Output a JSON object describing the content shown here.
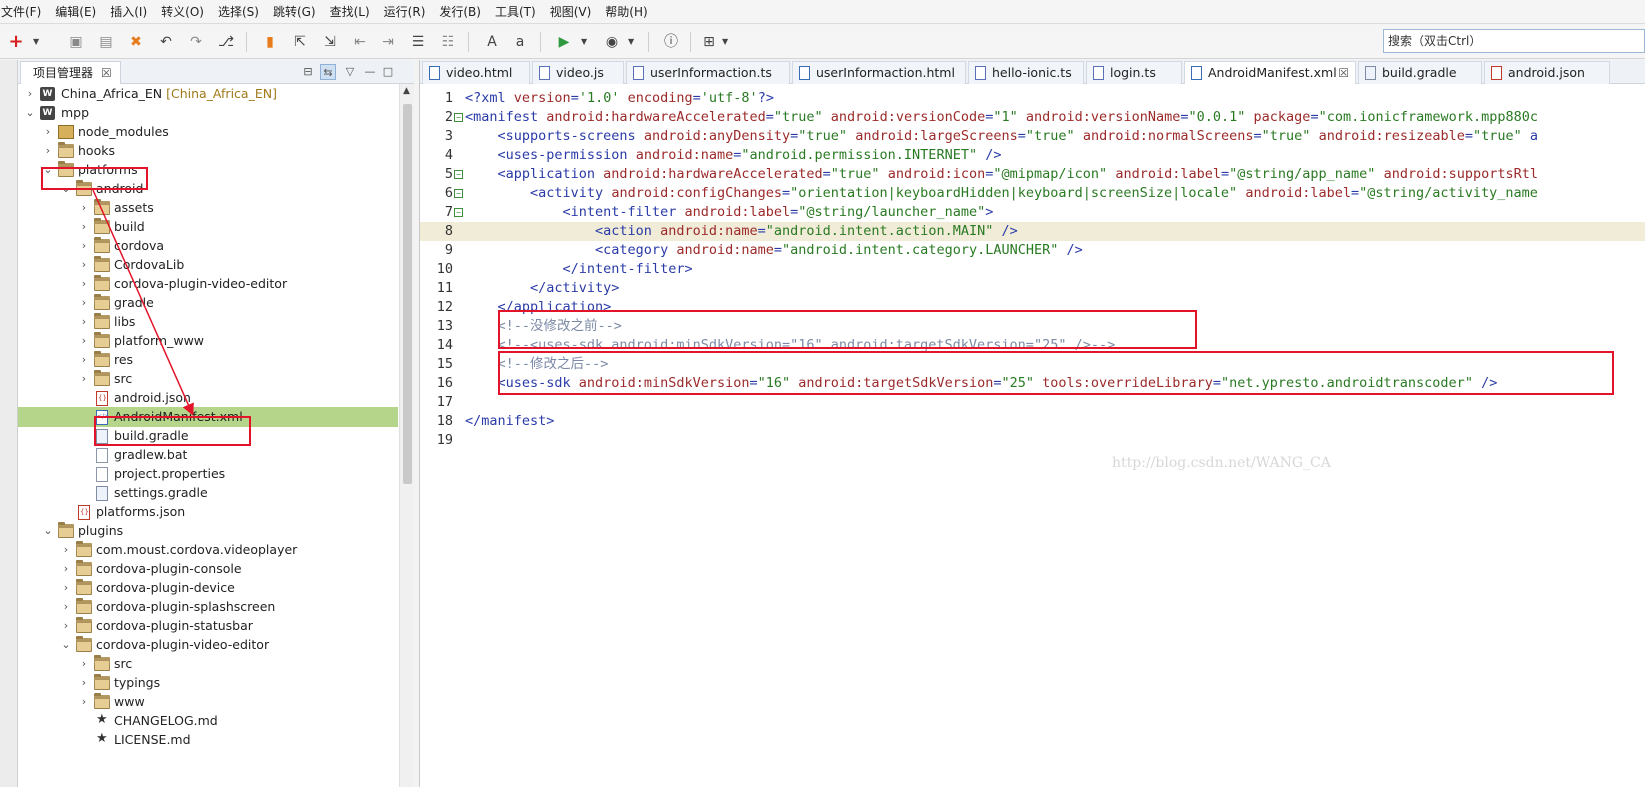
{
  "menu": [
    "文件(F)",
    "编辑(E)",
    "插入(I)",
    "转义(O)",
    "选择(S)",
    "跳转(G)",
    "查找(L)",
    "运行(R)",
    "发行(B)",
    "工具(T)",
    "视图(V)",
    "帮助(H)"
  ],
  "search": {
    "placeholder": "搜索（双击Ctrl）"
  },
  "project_panel": {
    "title": "项目管理器",
    "close": "☒"
  },
  "tree": [
    {
      "label": "China_Africa_EN",
      "extra": "[China_Africa_EN]"
    },
    {
      "label": "mpp"
    },
    {
      "label": "node_modules"
    },
    {
      "label": "hooks"
    },
    {
      "label": "platforms"
    },
    {
      "label": "android"
    },
    {
      "label": "assets"
    },
    {
      "label": "build"
    },
    {
      "label": "cordova"
    },
    {
      "label": "CordovaLib"
    },
    {
      "label": "cordova-plugin-video-editor"
    },
    {
      "label": "gradle"
    },
    {
      "label": "libs"
    },
    {
      "label": "platform_www"
    },
    {
      "label": "res"
    },
    {
      "label": "src"
    },
    {
      "label": "android.json"
    },
    {
      "label": "AndroidManifest.xml"
    },
    {
      "label": "build.gradle"
    },
    {
      "label": "gradlew.bat"
    },
    {
      "label": "project.properties"
    },
    {
      "label": "settings.gradle"
    },
    {
      "label": "platforms.json"
    },
    {
      "label": "plugins"
    },
    {
      "label": "com.moust.cordova.videoplayer"
    },
    {
      "label": "cordova-plugin-console"
    },
    {
      "label": "cordova-plugin-device"
    },
    {
      "label": "cordova-plugin-splashscreen"
    },
    {
      "label": "cordova-plugin-statusbar"
    },
    {
      "label": "cordova-plugin-video-editor"
    },
    {
      "label": "src"
    },
    {
      "label": "typings"
    },
    {
      "label": "www"
    },
    {
      "label": "CHANGELOG.md"
    },
    {
      "label": "LICENSE.md"
    }
  ],
  "tabs": [
    {
      "label": "video.html"
    },
    {
      "label": "video.js"
    },
    {
      "label": "userInformaction.ts"
    },
    {
      "label": "userInformaction.html"
    },
    {
      "label": "hello-ionic.ts"
    },
    {
      "label": "login.ts"
    },
    {
      "label": "AndroidManifest.xml",
      "close": "☒"
    },
    {
      "label": "build.gradle"
    },
    {
      "label": "android.json"
    }
  ],
  "code_lines": [
    {
      "n": "1",
      "tokens": [
        [
          "t-tag",
          "<?xml "
        ],
        [
          "t-attr",
          "version"
        ],
        [
          "t-tag",
          "="
        ],
        [
          "t-val",
          "'1.0'"
        ],
        [
          "t-tag",
          " "
        ],
        [
          "t-attr",
          "encoding"
        ],
        [
          "t-tag",
          "="
        ],
        [
          "t-val",
          "'utf-8'"
        ],
        [
          "t-tag",
          "?>"
        ]
      ]
    },
    {
      "n": "2",
      "tokens": [
        [
          "t-tag",
          "<manifest "
        ],
        [
          "t-attr",
          "android:hardwareAccelerated"
        ],
        [
          "t-tag",
          "="
        ],
        [
          "t-val",
          "\"true\""
        ],
        [
          "t-tag",
          " "
        ],
        [
          "t-attr",
          "android:versionCode"
        ],
        [
          "t-tag",
          "="
        ],
        [
          "t-val",
          "\"1\""
        ],
        [
          "t-tag",
          " "
        ],
        [
          "t-attr",
          "android:versionName"
        ],
        [
          "t-tag",
          "="
        ],
        [
          "t-val",
          "\"0.0.1\""
        ],
        [
          "t-tag",
          " "
        ],
        [
          "t-attr",
          "package"
        ],
        [
          "t-tag",
          "="
        ],
        [
          "t-val",
          "\"com.ionicframework.mpp880c"
        ]
      ]
    },
    {
      "n": "3",
      "tokens": [
        [
          "t-tag",
          "    <supports-screens "
        ],
        [
          "t-attr",
          "android:anyDensity"
        ],
        [
          "t-tag",
          "="
        ],
        [
          "t-val",
          "\"true\""
        ],
        [
          "t-tag",
          " "
        ],
        [
          "t-attr",
          "android:largeScreens"
        ],
        [
          "t-tag",
          "="
        ],
        [
          "t-val",
          "\"true\""
        ],
        [
          "t-tag",
          " "
        ],
        [
          "t-attr",
          "android:normalScreens"
        ],
        [
          "t-tag",
          "="
        ],
        [
          "t-val",
          "\"true\""
        ],
        [
          "t-tag",
          " "
        ],
        [
          "t-attr",
          "android:resizeable"
        ],
        [
          "t-tag",
          "="
        ],
        [
          "t-val",
          "\"true\""
        ],
        [
          "t-tag",
          " a"
        ]
      ]
    },
    {
      "n": "4",
      "tokens": [
        [
          "t-tag",
          "    <uses-permission "
        ],
        [
          "t-attr",
          "android:name"
        ],
        [
          "t-tag",
          "="
        ],
        [
          "t-val",
          "\"android.permission.INTERNET\""
        ],
        [
          "t-tag",
          " />"
        ]
      ]
    },
    {
      "n": "5",
      "tokens": [
        [
          "t-tag",
          "    <application "
        ],
        [
          "t-attr",
          "android:hardwareAccelerated"
        ],
        [
          "t-tag",
          "="
        ],
        [
          "t-val",
          "\"true\""
        ],
        [
          "t-tag",
          " "
        ],
        [
          "t-attr",
          "android:icon"
        ],
        [
          "t-tag",
          "="
        ],
        [
          "t-val",
          "\"@mipmap/icon\""
        ],
        [
          "t-tag",
          " "
        ],
        [
          "t-attr",
          "android:label"
        ],
        [
          "t-tag",
          "="
        ],
        [
          "t-val",
          "\"@string/app_name\""
        ],
        [
          "t-tag",
          " "
        ],
        [
          "t-attr",
          "android:supportsRtl"
        ]
      ]
    },
    {
      "n": "6",
      "tokens": [
        [
          "t-tag",
          "        <activity "
        ],
        [
          "t-attr",
          "android:configChanges"
        ],
        [
          "t-tag",
          "="
        ],
        [
          "t-val",
          "\"orientation|keyboardHidden|keyboard|screenSize|locale\""
        ],
        [
          "t-tag",
          " "
        ],
        [
          "t-attr",
          "android:label"
        ],
        [
          "t-tag",
          "="
        ],
        [
          "t-val",
          "\"@string/activity_name"
        ]
      ]
    },
    {
      "n": "7",
      "tokens": [
        [
          "t-tag",
          "            <intent-filter "
        ],
        [
          "t-attr",
          "android:label"
        ],
        [
          "t-tag",
          "="
        ],
        [
          "t-val",
          "\"@string/launcher_name\""
        ],
        [
          "t-tag",
          ">"
        ]
      ]
    },
    {
      "n": "8",
      "tokens": [
        [
          "t-tag",
          "                <action "
        ],
        [
          "t-attr",
          "android:name"
        ],
        [
          "t-tag",
          "="
        ],
        [
          "t-val",
          "\"android.intent.action.MAIN\""
        ],
        [
          "t-tag",
          " />"
        ]
      ]
    },
    {
      "n": "9",
      "tokens": [
        [
          "t-tag",
          "                <category "
        ],
        [
          "t-attr",
          "android:name"
        ],
        [
          "t-tag",
          "="
        ],
        [
          "t-val",
          "\"android.intent.category.LAUNCHER\""
        ],
        [
          "t-tag",
          " />"
        ]
      ]
    },
    {
      "n": "10",
      "tokens": [
        [
          "t-tag",
          "            </intent-filter>"
        ]
      ]
    },
    {
      "n": "11",
      "tokens": [
        [
          "t-tag",
          "        </activity>"
        ]
      ]
    },
    {
      "n": "12",
      "tokens": [
        [
          "t-tag",
          "    </application>"
        ]
      ]
    },
    {
      "n": "13",
      "tokens": [
        [
          "t-com",
          "    <!--没修改之前-->"
        ]
      ]
    },
    {
      "n": "14",
      "tokens": [
        [
          "t-com",
          "    <!--<uses-sdk android:minSdkVersion=\"16\" android:targetSdkVersion=\"25\" />-->"
        ]
      ]
    },
    {
      "n": "15",
      "tokens": [
        [
          "t-com",
          "    <!--修改之后-->"
        ]
      ]
    },
    {
      "n": "16",
      "tokens": [
        [
          "t-tag",
          "    <uses-sdk "
        ],
        [
          "t-attr",
          "android:minSdkVersion"
        ],
        [
          "t-tag",
          "="
        ],
        [
          "t-val",
          "\"16\""
        ],
        [
          "t-tag",
          " "
        ],
        [
          "t-attr",
          "android:targetSdkVersion"
        ],
        [
          "t-tag",
          "="
        ],
        [
          "t-val",
          "\"25\""
        ],
        [
          "t-tag",
          " "
        ],
        [
          "t-attr",
          "tools:overrideLibrary"
        ],
        [
          "t-tag",
          "="
        ],
        [
          "t-val",
          "\"net.ypresto.androidtranscoder\""
        ],
        [
          "t-tag",
          " />"
        ]
      ]
    },
    {
      "n": "17",
      "tokens": []
    },
    {
      "n": "18",
      "tokens": [
        [
          "t-tag",
          "</manifest>"
        ]
      ]
    },
    {
      "n": "19",
      "tokens": []
    }
  ],
  "watermark": "http://blog.csdn.net/WANG_CA",
  "colors": {
    "highlight_box": "#e3142a",
    "selected_row": "#b5d58b",
    "arrow": "#e3142a"
  }
}
